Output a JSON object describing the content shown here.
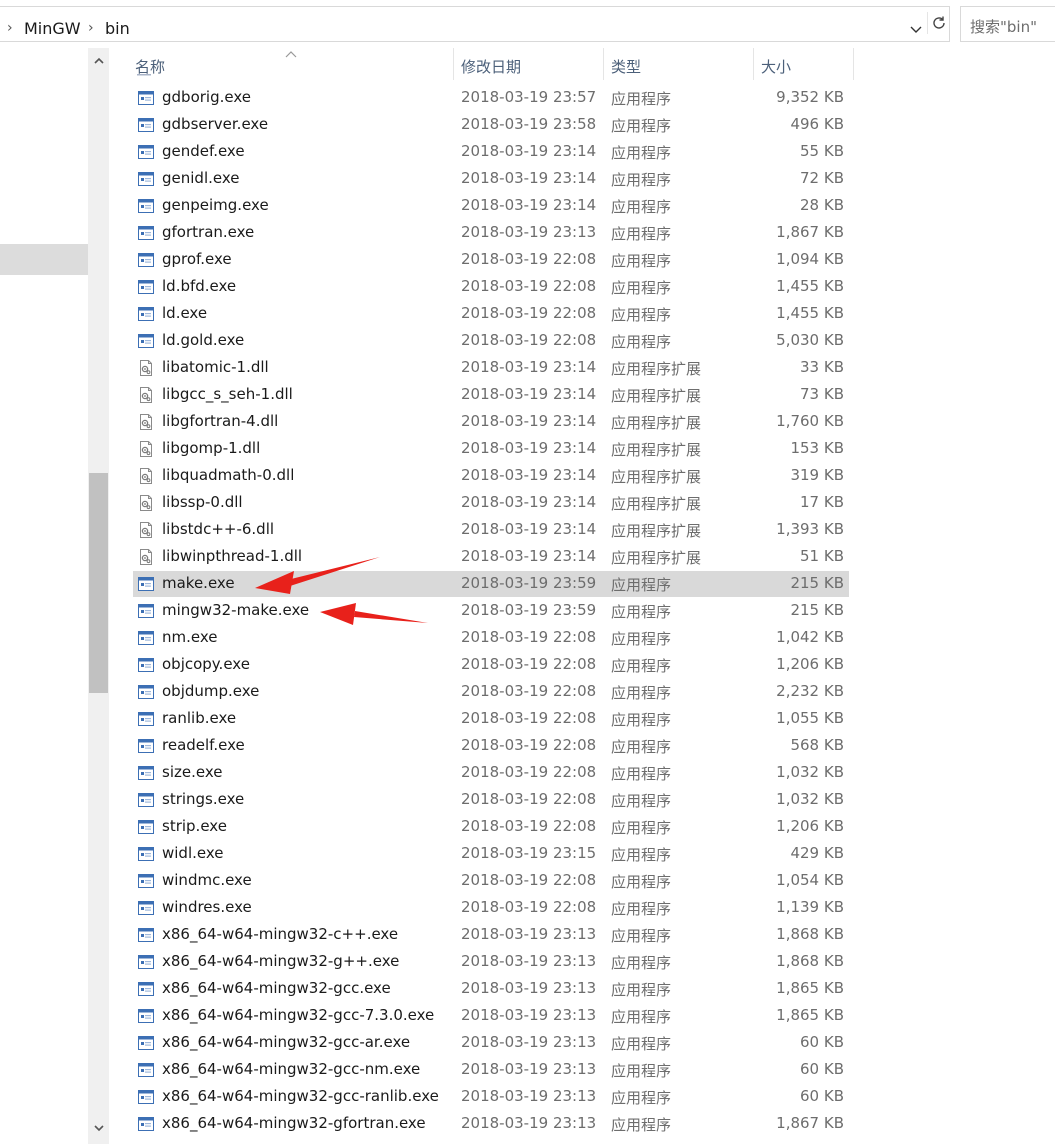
{
  "address_bar": {
    "crumbs": [
      "MinGW",
      "bin"
    ],
    "search_placeholder": "搜索\"bin\""
  },
  "columns": {
    "name": "名称",
    "date": "修改日期",
    "type": "类型",
    "size": "大小"
  },
  "files": [
    {
      "name": "gdborig.exe",
      "date": "2018-03-19 23:57",
      "type": "应用程序",
      "size": "9,352 KB",
      "kind": "exe"
    },
    {
      "name": "gdbserver.exe",
      "date": "2018-03-19 23:58",
      "type": "应用程序",
      "size": "496 KB",
      "kind": "exe"
    },
    {
      "name": "gendef.exe",
      "date": "2018-03-19 23:14",
      "type": "应用程序",
      "size": "55 KB",
      "kind": "exe"
    },
    {
      "name": "genidl.exe",
      "date": "2018-03-19 23:14",
      "type": "应用程序",
      "size": "72 KB",
      "kind": "exe"
    },
    {
      "name": "genpeimg.exe",
      "date": "2018-03-19 23:14",
      "type": "应用程序",
      "size": "28 KB",
      "kind": "exe"
    },
    {
      "name": "gfortran.exe",
      "date": "2018-03-19 23:13",
      "type": "应用程序",
      "size": "1,867 KB",
      "kind": "exe"
    },
    {
      "name": "gprof.exe",
      "date": "2018-03-19 22:08",
      "type": "应用程序",
      "size": "1,094 KB",
      "kind": "exe"
    },
    {
      "name": "ld.bfd.exe",
      "date": "2018-03-19 22:08",
      "type": "应用程序",
      "size": "1,455 KB",
      "kind": "exe"
    },
    {
      "name": "ld.exe",
      "date": "2018-03-19 22:08",
      "type": "应用程序",
      "size": "1,455 KB",
      "kind": "exe"
    },
    {
      "name": "ld.gold.exe",
      "date": "2018-03-19 22:08",
      "type": "应用程序",
      "size": "5,030 KB",
      "kind": "exe"
    },
    {
      "name": "libatomic-1.dll",
      "date": "2018-03-19 23:14",
      "type": "应用程序扩展",
      "size": "33 KB",
      "kind": "dll"
    },
    {
      "name": "libgcc_s_seh-1.dll",
      "date": "2018-03-19 23:14",
      "type": "应用程序扩展",
      "size": "73 KB",
      "kind": "dll"
    },
    {
      "name": "libgfortran-4.dll",
      "date": "2018-03-19 23:14",
      "type": "应用程序扩展",
      "size": "1,760 KB",
      "kind": "dll"
    },
    {
      "name": "libgomp-1.dll",
      "date": "2018-03-19 23:14",
      "type": "应用程序扩展",
      "size": "153 KB",
      "kind": "dll"
    },
    {
      "name": "libquadmath-0.dll",
      "date": "2018-03-19 23:14",
      "type": "应用程序扩展",
      "size": "319 KB",
      "kind": "dll"
    },
    {
      "name": "libssp-0.dll",
      "date": "2018-03-19 23:14",
      "type": "应用程序扩展",
      "size": "17 KB",
      "kind": "dll"
    },
    {
      "name": "libstdc++-6.dll",
      "date": "2018-03-19 23:14",
      "type": "应用程序扩展",
      "size": "1,393 KB",
      "kind": "dll"
    },
    {
      "name": "libwinpthread-1.dll",
      "date": "2018-03-19 23:14",
      "type": "应用程序扩展",
      "size": "51 KB",
      "kind": "dll"
    },
    {
      "name": "make.exe",
      "date": "2018-03-19 23:59",
      "type": "应用程序",
      "size": "215 KB",
      "kind": "exe",
      "selected": true
    },
    {
      "name": "mingw32-make.exe",
      "date": "2018-03-19 23:59",
      "type": "应用程序",
      "size": "215 KB",
      "kind": "exe"
    },
    {
      "name": "nm.exe",
      "date": "2018-03-19 22:08",
      "type": "应用程序",
      "size": "1,042 KB",
      "kind": "exe"
    },
    {
      "name": "objcopy.exe",
      "date": "2018-03-19 22:08",
      "type": "应用程序",
      "size": "1,206 KB",
      "kind": "exe"
    },
    {
      "name": "objdump.exe",
      "date": "2018-03-19 22:08",
      "type": "应用程序",
      "size": "2,232 KB",
      "kind": "exe"
    },
    {
      "name": "ranlib.exe",
      "date": "2018-03-19 22:08",
      "type": "应用程序",
      "size": "1,055 KB",
      "kind": "exe"
    },
    {
      "name": "readelf.exe",
      "date": "2018-03-19 22:08",
      "type": "应用程序",
      "size": "568 KB",
      "kind": "exe"
    },
    {
      "name": "size.exe",
      "date": "2018-03-19 22:08",
      "type": "应用程序",
      "size": "1,032 KB",
      "kind": "exe"
    },
    {
      "name": "strings.exe",
      "date": "2018-03-19 22:08",
      "type": "应用程序",
      "size": "1,032 KB",
      "kind": "exe"
    },
    {
      "name": "strip.exe",
      "date": "2018-03-19 22:08",
      "type": "应用程序",
      "size": "1,206 KB",
      "kind": "exe"
    },
    {
      "name": "widl.exe",
      "date": "2018-03-19 23:15",
      "type": "应用程序",
      "size": "429 KB",
      "kind": "exe"
    },
    {
      "name": "windmc.exe",
      "date": "2018-03-19 22:08",
      "type": "应用程序",
      "size": "1,054 KB",
      "kind": "exe"
    },
    {
      "name": "windres.exe",
      "date": "2018-03-19 22:08",
      "type": "应用程序",
      "size": "1,139 KB",
      "kind": "exe"
    },
    {
      "name": "x86_64-w64-mingw32-c++.exe",
      "date": "2018-03-19 23:13",
      "type": "应用程序",
      "size": "1,868 KB",
      "kind": "exe"
    },
    {
      "name": "x86_64-w64-mingw32-g++.exe",
      "date": "2018-03-19 23:13",
      "type": "应用程序",
      "size": "1,868 KB",
      "kind": "exe"
    },
    {
      "name": "x86_64-w64-mingw32-gcc.exe",
      "date": "2018-03-19 23:13",
      "type": "应用程序",
      "size": "1,865 KB",
      "kind": "exe"
    },
    {
      "name": "x86_64-w64-mingw32-gcc-7.3.0.exe",
      "date": "2018-03-19 23:13",
      "type": "应用程序",
      "size": "1,865 KB",
      "kind": "exe"
    },
    {
      "name": "x86_64-w64-mingw32-gcc-ar.exe",
      "date": "2018-03-19 23:13",
      "type": "应用程序",
      "size": "60 KB",
      "kind": "exe"
    },
    {
      "name": "x86_64-w64-mingw32-gcc-nm.exe",
      "date": "2018-03-19 23:13",
      "type": "应用程序",
      "size": "60 KB",
      "kind": "exe"
    },
    {
      "name": "x86_64-w64-mingw32-gcc-ranlib.exe",
      "date": "2018-03-19 23:13",
      "type": "应用程序",
      "size": "60 KB",
      "kind": "exe"
    },
    {
      "name": "x86_64-w64-mingw32-gfortran.exe",
      "date": "2018-03-19 23:13",
      "type": "应用程序",
      "size": "1,867 KB",
      "kind": "exe"
    }
  ],
  "icons": {
    "breadcrumb_separator": "chevron-right-icon",
    "address_dropdown": "chevron-down-icon",
    "refresh": "refresh-icon",
    "exe_file": "application-icon",
    "dll_file": "dll-gear-icon",
    "annotation": "red-arrow-icon"
  },
  "colors": {
    "selection": "#d9d9d9",
    "annotation_arrow": "#e8211b",
    "header_text": "#4c607a"
  }
}
